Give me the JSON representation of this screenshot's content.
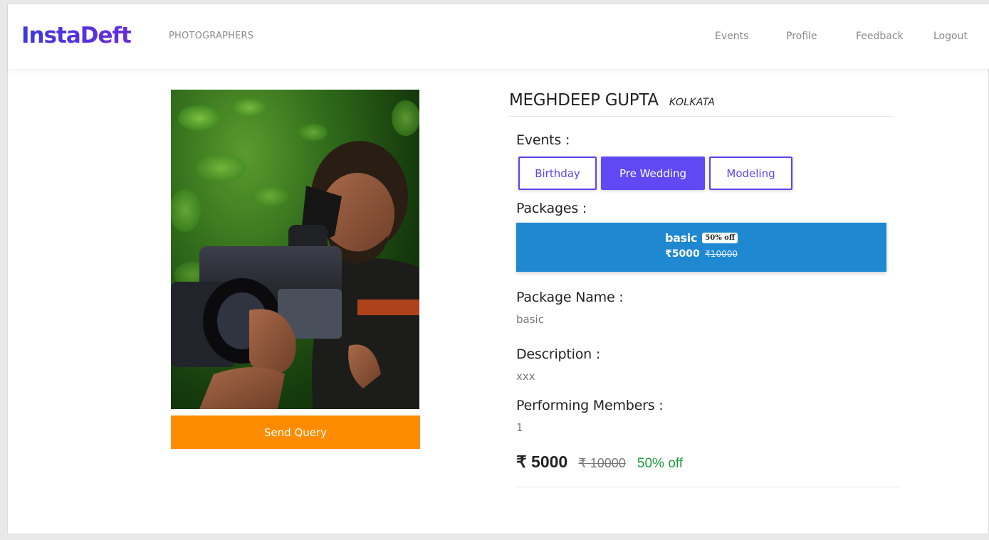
{
  "header": {
    "brand": "InstaDeft",
    "nav_left": "PHOTOGRAPHERS",
    "nav_right": [
      "Events",
      "Profile",
      "Feedback",
      "Logout"
    ]
  },
  "photographer": {
    "name": "MEGHDEEP GUPTA",
    "city": "KOLKATA",
    "photo_icon": "photographer-with-camera-photo"
  },
  "actions": {
    "send_query": "Send Query"
  },
  "events": {
    "label": "Events :",
    "items": [
      {
        "label": "Birthday",
        "active": false
      },
      {
        "label": "Pre Wedding",
        "active": true
      },
      {
        "label": "Modeling",
        "active": false
      }
    ]
  },
  "packages": {
    "label": "Packages :",
    "items": [
      {
        "name": "basic",
        "badge": "50% off",
        "price": "₹5000",
        "old_price": "₹10000"
      }
    ]
  },
  "details": {
    "package_name_label": "Package Name :",
    "package_name": "basic",
    "description_label": "Description :",
    "description": "xxx",
    "members_label": "Performing Members :",
    "members": "1"
  },
  "pricing": {
    "final": "₹ 5000",
    "original": "₹ 10000",
    "discount": "50% off"
  },
  "colors": {
    "brand_start": "#3d39e0",
    "brand_end": "#6b2bd9",
    "accent_purple": "#6049f5",
    "send_button": "#ff8c00",
    "package_card": "#1e88d1",
    "discount_green": "#1c9b3b"
  }
}
